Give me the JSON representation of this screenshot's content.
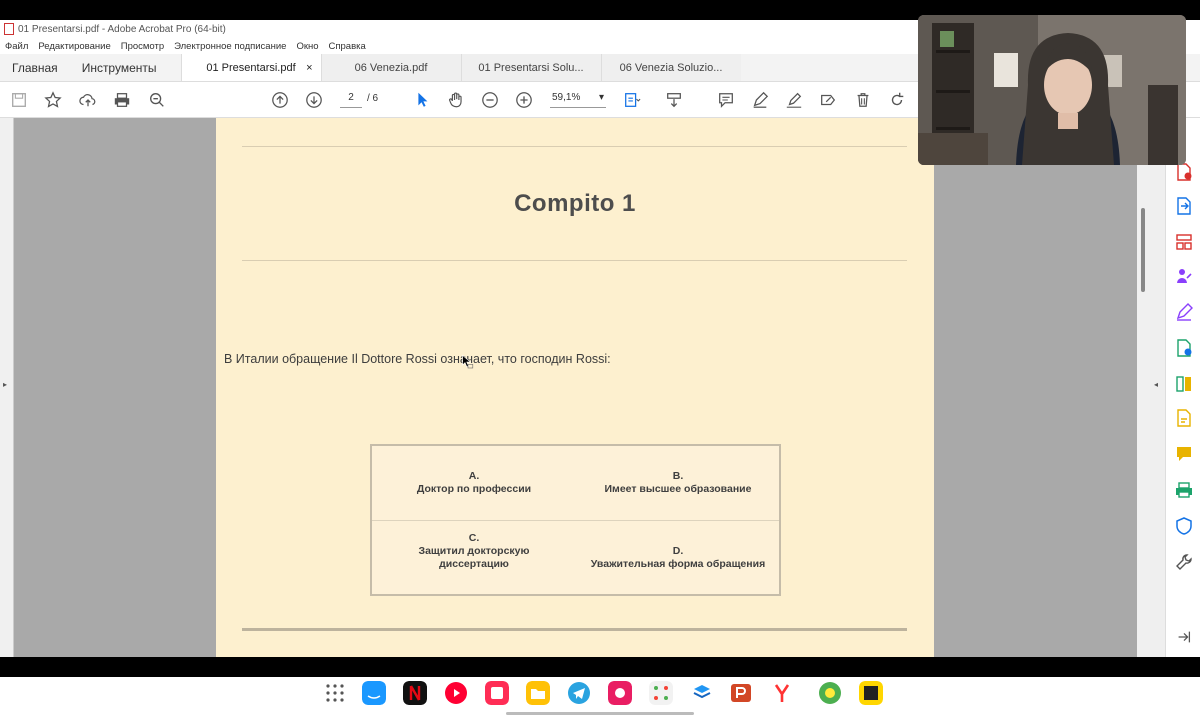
{
  "window": {
    "title": "01 Presentarsi.pdf - Adobe Acrobat Pro (64-bit)"
  },
  "menu": {
    "items": [
      "Файл",
      "Редактирование",
      "Просмотр",
      "Электронное подписание",
      "Окно",
      "Справка"
    ]
  },
  "nav_tabs": {
    "home": "Главная",
    "tools": "Инструменты"
  },
  "doc_tabs": [
    {
      "label": "01 Presentarsi.pdf",
      "active": true
    },
    {
      "label": "06 Venezia.pdf",
      "active": false
    },
    {
      "label": "01 Presentarsi Solu...",
      "active": false
    },
    {
      "label": "06 Venezia Soluzio...",
      "active": false
    }
  ],
  "close_glyph": "×",
  "toolbar": {
    "current_page": "2",
    "total_pages": "/ 6",
    "zoom": "59,1%",
    "zoom_caret": "▾"
  },
  "document": {
    "heading": "Compito 1",
    "question": "В Италии обращение Il Dottore Rossi означает, что господин Rossi:",
    "answers": {
      "a_letter": "A.",
      "a_text": "Доктор по профессии",
      "b_letter": "B.",
      "b_text": "Имеет высшее образование",
      "c_letter": "C.",
      "c_line1": "Защитил докторскую",
      "c_line2": "диссертацию",
      "d_letter": "D.",
      "d_text": "Уважительная форма обращения"
    }
  },
  "panel_arrows": {
    "left": "▸",
    "right": "◂"
  },
  "colors": {
    "page_bg": "#fdf0cf",
    "doc_bg": "#a9a9a9",
    "accent": "#1473e6"
  }
}
